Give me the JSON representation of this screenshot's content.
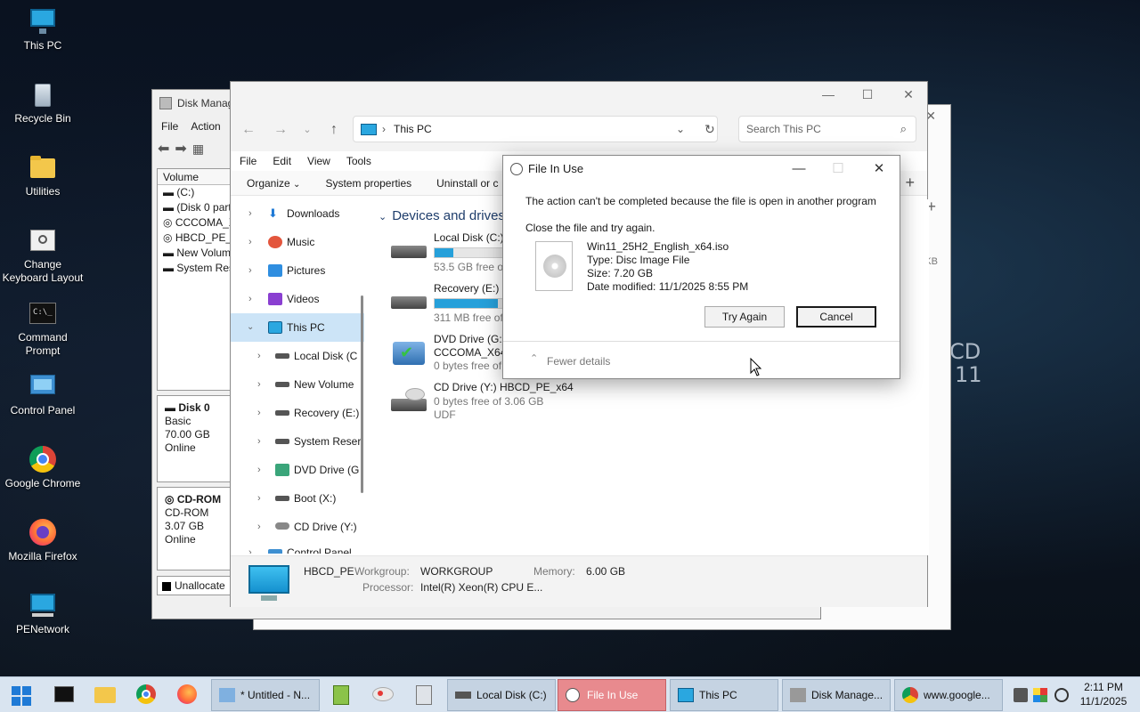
{
  "desktop": {
    "icons": [
      {
        "label": "This PC"
      },
      {
        "label": "Recycle Bin"
      },
      {
        "label": "Utilities"
      },
      {
        "label": "Change Keyboard Layout"
      },
      {
        "label": "Command Prompt"
      },
      {
        "label": "Control Panel"
      },
      {
        "label": "Google Chrome"
      },
      {
        "label": "Mozilla Firefox"
      },
      {
        "label": "PENetwork"
      }
    ],
    "background_text_line1": "CD",
    "background_text_line2": "11"
  },
  "disk_management": {
    "title": "Disk Manag",
    "menu": [
      "File",
      "Action"
    ],
    "list_header": "Volume",
    "volumes": [
      "(C:)",
      "(Disk 0 parti",
      "CCCOMA_X",
      "HBCD_PE_x",
      "New Volum",
      "System Rese"
    ],
    "disk0": {
      "name": "Disk 0",
      "type": "Basic",
      "size": "70.00 GB",
      "status": "Online"
    },
    "cdrom": {
      "name": "CD-ROM",
      "type": "CD-ROM",
      "size": "3.07 GB",
      "status": "Online"
    },
    "legend": "Unallocate"
  },
  "back_window": {
    "right_text": "KB"
  },
  "explorer": {
    "address": "This PC",
    "search_placeholder": "Search This PC",
    "menu": [
      "File",
      "Edit",
      "View",
      "Tools"
    ],
    "commands": {
      "organize": "Organize",
      "system_properties": "System properties",
      "uninstall": "Uninstall or c"
    },
    "sidebar": [
      {
        "label": "Downloads"
      },
      {
        "label": "Music"
      },
      {
        "label": "Pictures"
      },
      {
        "label": "Videos"
      },
      {
        "label": "This PC"
      },
      {
        "label": "Local Disk (C"
      },
      {
        "label": "New Volume"
      },
      {
        "label": "Recovery (E:)"
      },
      {
        "label": "System Reser"
      },
      {
        "label": "DVD Drive (G"
      },
      {
        "label": "Boot (X:)"
      },
      {
        "label": "CD Drive (Y:)"
      },
      {
        "label": "Control Panel"
      }
    ],
    "group_title": "Devices and drives",
    "drives": [
      {
        "name": "Local Disk (C:)",
        "free": "53.5 GB free of",
        "used_fraction": 0.18
      },
      {
        "name": "Recovery (E:)",
        "free": "311 MB free of",
        "used_fraction": 0.6
      },
      {
        "name": "DVD Drive (G:)",
        "label": "CCCOMA_X64",
        "free": "0 bytes free of"
      },
      {
        "name": "CD Drive (Y:) HBCD_PE_x64",
        "free": "0 bytes free of 3.06 GB",
        "fs": "UDF"
      }
    ],
    "status": {
      "computer": "HBCD_PE",
      "workgroup_label": "Workgroup:",
      "workgroup": "WORKGROUP",
      "memory_label": "Memory:",
      "memory": "6.00 GB",
      "processor_label": "Processor:",
      "processor": "Intel(R) Xeon(R) CPU E..."
    }
  },
  "dialog": {
    "title": "File In Use",
    "message": "The action can't be completed because the file is open in another program",
    "instruction": "Close the file and try again.",
    "file_name": "Win11_25H2_English_x64.iso",
    "file_type": "Type: Disc Image File",
    "file_size": "Size: 7.20 GB",
    "file_date": "Date modified: 11/1/2025 8:55 PM",
    "try_again": "Try Again",
    "cancel": "Cancel",
    "fewer_details": "Fewer details"
  },
  "taskbar": {
    "buttons": [
      {
        "label": "* Untitled - N..."
      },
      {
        "label": "Local Disk (C:)"
      },
      {
        "label": "File In Use"
      },
      {
        "label": "This PC"
      },
      {
        "label": "Disk Manage..."
      },
      {
        "label": "www.google..."
      }
    ],
    "time": "2:11 PM",
    "date": "11/1/2025"
  },
  "colors": {
    "accent": "#26a0da",
    "active_task": "#e88a8e",
    "selection": "#cce4f7"
  }
}
